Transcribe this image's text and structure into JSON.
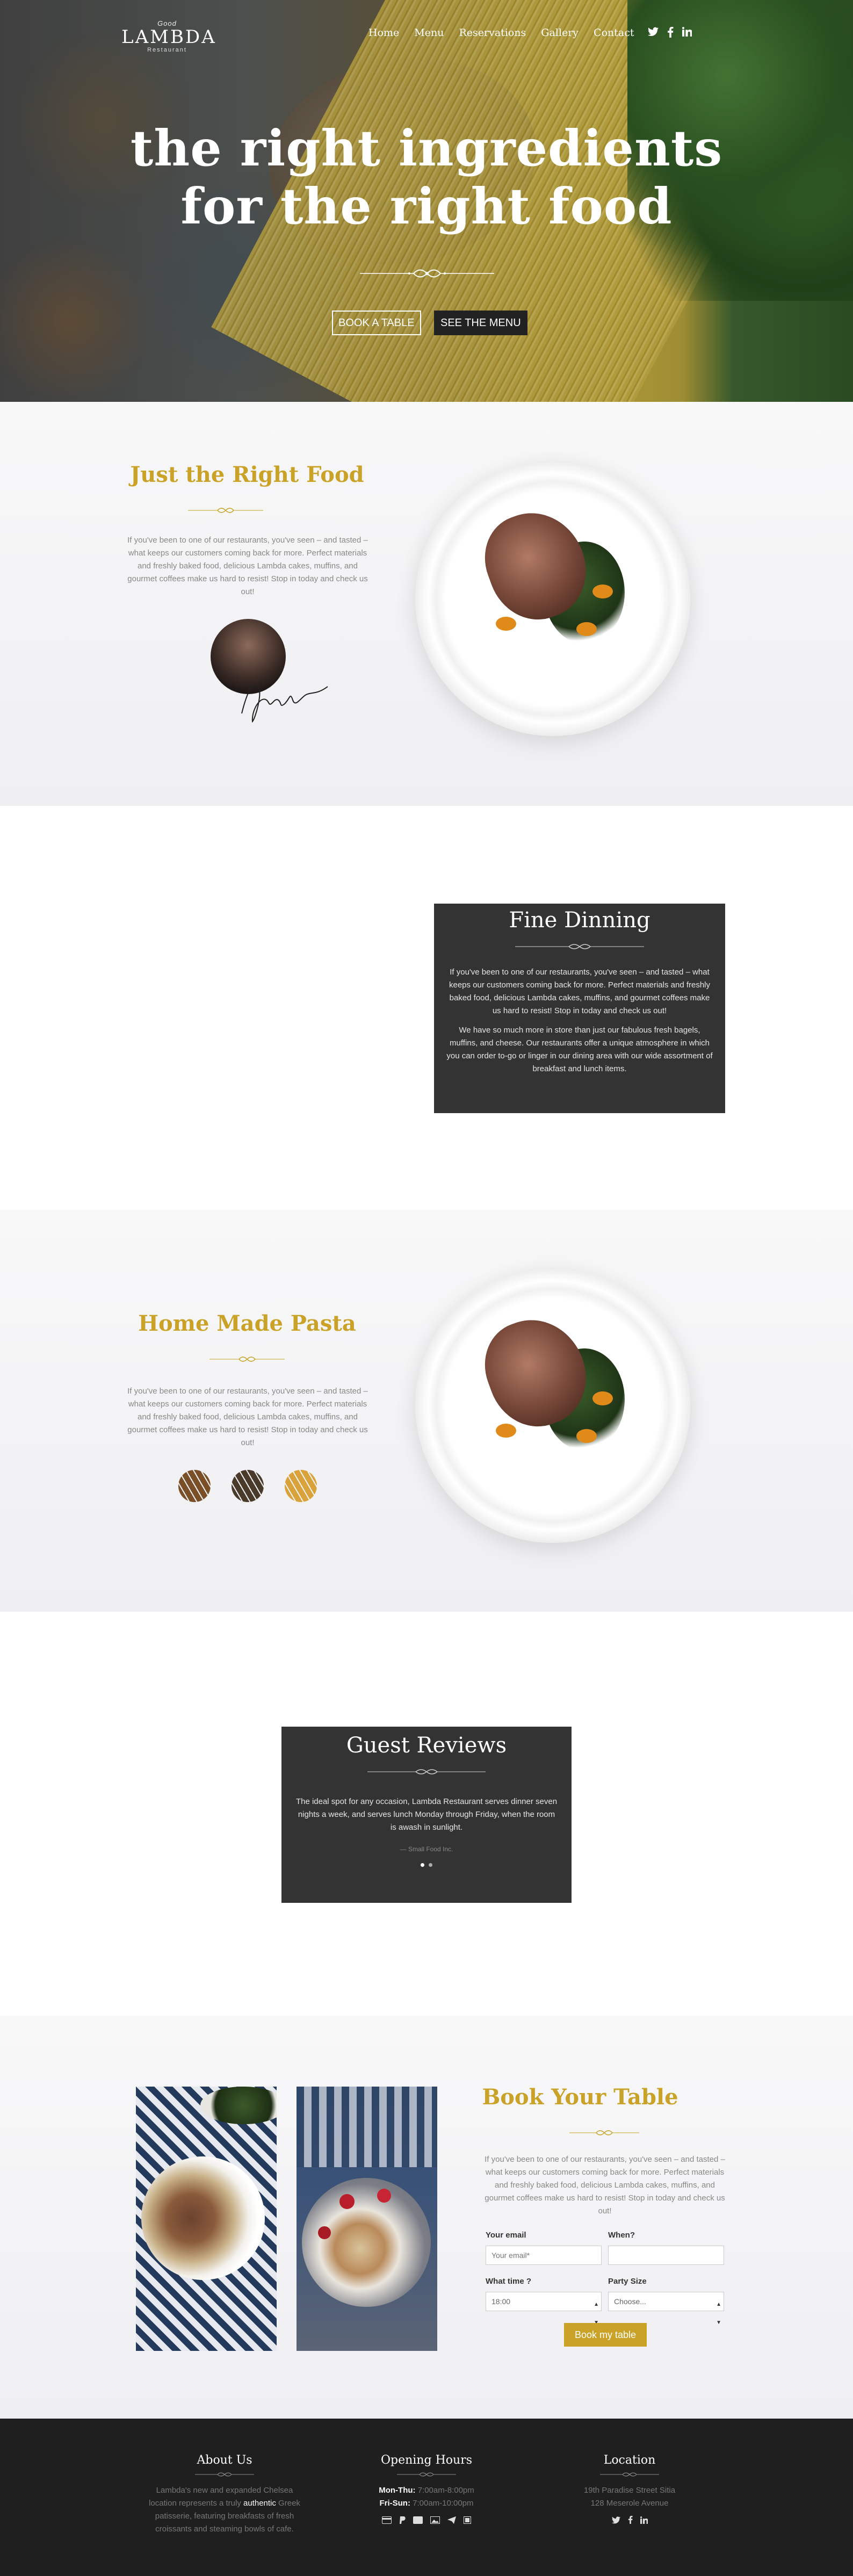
{
  "brand": {
    "small": "Good",
    "name": "LAMBDA",
    "sub": "Restaurant"
  },
  "nav": [
    "Home",
    "Menu",
    "Reservations",
    "Gallery",
    "Contact"
  ],
  "social_icons": [
    "twitter-icon",
    "facebook-icon",
    "linkedin-icon"
  ],
  "hero": {
    "line1": "the right ingredients",
    "line2": "for the right food",
    "book_button": "BOOK A TABLE",
    "menu_button": "SEE THE MENU"
  },
  "right_food": {
    "title": "Just the Right Food",
    "text": "If you've been to one of our restaurants, you've seen – and tasted – what keeps our customers coming back for more. Perfect materials and freshly baked food, delicious Lambda cakes, muffins, and gourmet coffees make us hard to resist! Stop in today and check us out!"
  },
  "fine_dinning": {
    "title": "Fine Dinning",
    "p1": "If you've been to one of our restaurants, you've seen – and tasted – what keeps our customers coming back for more. Perfect materials and freshly baked food, delicious Lambda cakes, muffins, and gourmet coffees make us hard to resist! Stop in today and check us out!",
    "p2": "We have so much more in store than just our fabulous fresh bagels, muffins, and cheese. Our restaurants offer a unique atmosphere in which you can order to-go or linger in our dining area with our wide assortment of breakfast and lunch items."
  },
  "pasta": {
    "title": "Home Made Pasta",
    "text": "If you've been to one of our restaurants, you've seen – and tasted – what keeps our customers coming back for more. Perfect materials and freshly baked food, delicious Lambda cakes, muffins, and gourmet coffees make us hard to resist! Stop in today and check us out!",
    "swatch_colors": [
      "#7a4f28",
      "#4a3a2a",
      "#d9a23a"
    ]
  },
  "reviews": {
    "title": "Guest Reviews",
    "quote": "The ideal spot for any occasion, Lambda Restaurant serves dinner seven nights a week, and serves lunch Monday through Friday, when the room is awash in sunlight.",
    "author": "— Small Food Inc.",
    "dots": 2
  },
  "book": {
    "title": "Book Your Table",
    "text": "If you've been to one of our restaurants, you've seen – and tasted – what keeps our customers coming back for more. Perfect materials and freshly baked food, delicious Lambda cakes, muffins, and gourmet coffees make us hard to resist! Stop in today and check us out!",
    "email_label": "Your email",
    "email_placeholder": "Your email*",
    "when_label": "When?",
    "time_label": "What time ?",
    "time_value": "18:00",
    "party_label": "Party Size",
    "party_value": "Choose...",
    "button": "Book my table"
  },
  "footer": {
    "about": {
      "title": "About Us",
      "text1": "Lambda's new and expanded Chelsea location represents a truly ",
      "highlight": "authentic",
      "text2": " Greek patisserie, featuring breakfasts of fresh croissants and steaming bowls of cafe."
    },
    "hours": {
      "title": "Opening Hours",
      "row1_label": "Mon-Thu:",
      "row1_value": " 7:00am-8:00pm",
      "row2_label": "Fri-Sun:",
      "row2_value": " 7:00am-10:00pm",
      "icons": [
        "credit-card-icon",
        "paypal-icon",
        "card-icon",
        "image-icon",
        "send-icon",
        "grid-icon"
      ]
    },
    "location": {
      "title": "Location",
      "line1": "19th Paradise Street Sitia",
      "line2": "128 Meserole Avenue"
    }
  },
  "colors": {
    "gold": "#c9a227",
    "dark": "#333333",
    "footer": "#1f1f1f"
  }
}
